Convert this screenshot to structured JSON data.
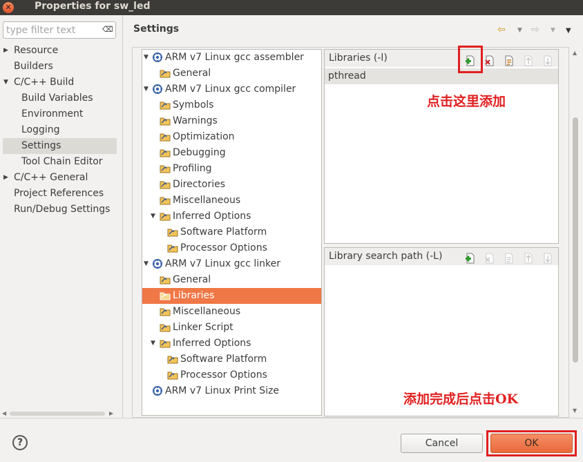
{
  "window": {
    "title": "Properties for sw_led",
    "close_glyph": "✕"
  },
  "filter": {
    "placeholder": "type filter text",
    "clear_glyph": "⌫"
  },
  "nav": {
    "items": [
      {
        "label": "Resource",
        "expander": "▶"
      },
      {
        "label": "Builders"
      },
      {
        "label": "C/C++ Build",
        "expander": "▼"
      },
      {
        "label": "Build Variables"
      },
      {
        "label": "Environment"
      },
      {
        "label": "Logging"
      },
      {
        "label": "Settings",
        "selected": true
      },
      {
        "label": "Tool Chain Editor"
      },
      {
        "label": "C/C++ General",
        "expander": "▶"
      },
      {
        "label": "Project References"
      },
      {
        "label": "Run/Debug Settings"
      }
    ]
  },
  "header": {
    "title": "Settings",
    "back_icon": "⇦",
    "back_dropdown": "▼",
    "forward_icon": "⇨",
    "forward_dropdown": "▼",
    "menu_icon": "▼"
  },
  "tool_tree": {
    "expander_open": "▼",
    "nodes": [
      {
        "label": "ARM v7 Linux gcc assembler",
        "icon": "gear-tool-icon"
      },
      {
        "label": "General",
        "icon": "folder-icon"
      },
      {
        "label": "ARM v7 Linux gcc compiler",
        "icon": "gear-tool-icon"
      },
      {
        "label": "Symbols",
        "icon": "folder-icon"
      },
      {
        "label": "Warnings",
        "icon": "folder-icon"
      },
      {
        "label": "Optimization",
        "icon": "folder-icon"
      },
      {
        "label": "Debugging",
        "icon": "folder-icon"
      },
      {
        "label": "Profiling",
        "icon": "folder-icon"
      },
      {
        "label": "Directories",
        "icon": "folder-icon"
      },
      {
        "label": "Miscellaneous",
        "icon": "folder-icon"
      },
      {
        "label": "Inferred Options",
        "icon": "folder-icon"
      },
      {
        "label": "Software Platform",
        "icon": "folder-icon"
      },
      {
        "label": "Processor Options",
        "icon": "folder-icon"
      },
      {
        "label": "ARM v7 Linux gcc linker",
        "icon": "gear-tool-icon"
      },
      {
        "label": "General",
        "icon": "folder-icon"
      },
      {
        "label": "Libraries",
        "icon": "folder-icon",
        "selected": true
      },
      {
        "label": "Miscellaneous",
        "icon": "folder-icon"
      },
      {
        "label": "Linker Script",
        "icon": "folder-icon"
      },
      {
        "label": "Inferred Options",
        "icon": "folder-icon"
      },
      {
        "label": "Software Platform",
        "icon": "folder-icon"
      },
      {
        "label": "Processor Options",
        "icon": "folder-icon"
      },
      {
        "label": "ARM v7 Linux Print Size",
        "icon": "gear-tool-icon"
      }
    ]
  },
  "libraries": {
    "title": "Libraries (-l)",
    "items": [
      "pthread"
    ],
    "toolbar": [
      "add-icon",
      "delete-icon",
      "edit-icon",
      "move-up-icon",
      "move-down-icon"
    ]
  },
  "library_search_path": {
    "title": "Library search path (-L)",
    "toolbar": [
      "add-icon",
      "delete-icon",
      "edit-icon",
      "move-up-icon",
      "move-down-icon"
    ]
  },
  "annotations": {
    "click_here_add": "点击这里添加",
    "after_add_click_ok": "添加完成后点击OK"
  },
  "buttons": {
    "help": "?",
    "cancel": "Cancel",
    "ok": "OK"
  },
  "colors": {
    "selection": "#f07746",
    "annotation": "#e02020"
  }
}
